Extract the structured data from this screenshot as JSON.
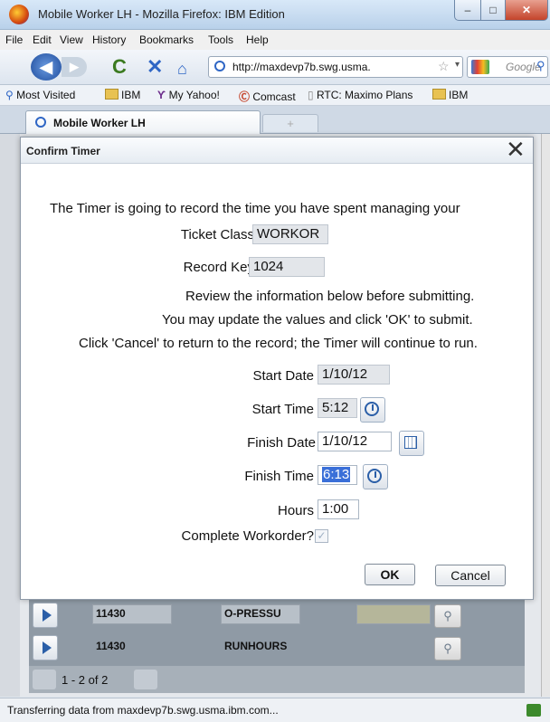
{
  "window": {
    "title": "Mobile Worker LH - Mozilla Firefox: IBM Edition",
    "min": "–",
    "max": "□",
    "close": "✕"
  },
  "menu": [
    "File",
    "Edit",
    "View",
    "History",
    "Bookmarks",
    "Tools",
    "Help"
  ],
  "nav": {
    "url": "http://maxdevp7b.swg.usma.",
    "search_placeholder": "Google"
  },
  "bookmarks": [
    "Most Visited",
    "IBM",
    "My Yahoo!",
    "Comcast",
    "RTC: Maximo Plans",
    "IBM"
  ],
  "tab": {
    "label": "Mobile Worker LH",
    "new_tab": "+"
  },
  "dialog": {
    "title": "Confirm Timer",
    "close": "✕",
    "intro": "The Timer is going to record the time you have spent managing your",
    "ticket_class_label": "Ticket Class",
    "ticket_class_value": "WORKOR",
    "record_key_label": "Record Key",
    "record_key_value": "1024",
    "instr1": "Review the information below before submitting.",
    "instr2": "You may update the values and click 'OK' to submit.",
    "instr3": "Click 'Cancel' to return to the record; the Timer will continue to run.",
    "start_date_label": "Start Date",
    "start_date_value": "1/10/12",
    "start_time_label": "Start Time",
    "start_time_value": "5:12",
    "finish_date_label": "Finish Date",
    "finish_date_value": "1/10/12",
    "finish_time_label": "Finish Time",
    "finish_time_value": "6:13",
    "hours_label": "Hours",
    "hours_value": "1:00",
    "complete_label": "Complete Workorder?",
    "complete_checked": "✓",
    "ok": "OK",
    "cancel": "Cancel"
  },
  "table": {
    "rows": [
      {
        "wo": "11430",
        "meter": "O-PRESSU"
      },
      {
        "wo": "11430",
        "meter": "RUNHOURS"
      }
    ],
    "pager": "1 - 2 of 2"
  },
  "status": "Transferring data from maxdevp7b.swg.usma.ibm.com...",
  "colors": {
    "accent": "#2b5fa8",
    "selection": "#3a6fd8"
  }
}
